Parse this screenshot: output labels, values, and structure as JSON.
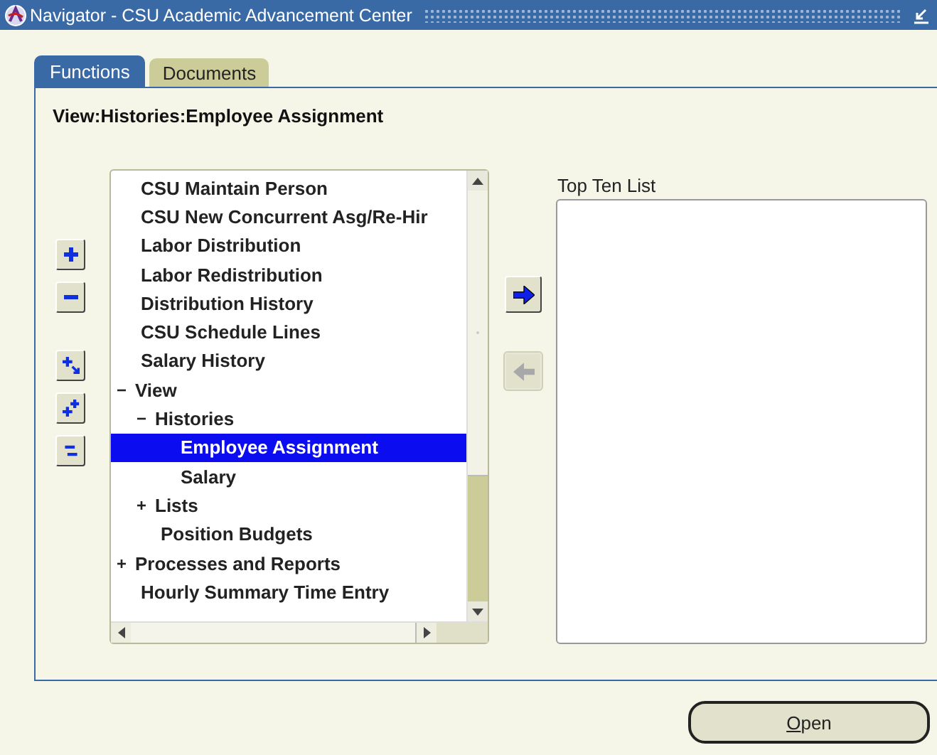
{
  "window": {
    "title": "Navigator - CSU Academic Advancement Center"
  },
  "tabs": [
    {
      "label": "Functions",
      "selected": true
    },
    {
      "label": "Documents",
      "selected": false
    }
  ],
  "path": "View:Histories:Employee Assignment",
  "tree": [
    {
      "label": "CSU Maintain Person",
      "selected": false
    },
    {
      "label": "CSU New Concurrent Asg/Re-Hir",
      "selected": false
    },
    {
      "label": "Labor Distribution",
      "selected": false
    },
    {
      "label": "Labor Redistribution",
      "selected": false
    },
    {
      "label": "Distribution History",
      "selected": false
    },
    {
      "label": "CSU Schedule Lines",
      "selected": false
    },
    {
      "label": "Salary History",
      "selected": false
    },
    {
      "label": "View",
      "selected": false,
      "expanded": true,
      "children": [
        {
          "label": "Histories",
          "selected": false,
          "expanded": true,
          "children": [
            {
              "label": "Employee Assignment",
              "selected": true
            },
            {
              "label": "Salary",
              "selected": false
            }
          ]
        },
        {
          "label": "Lists",
          "selected": false,
          "expanded": false
        },
        {
          "label": "Position Budgets",
          "selected": false
        }
      ]
    },
    {
      "label": "Processes and Reports",
      "selected": false,
      "expanded": false
    },
    {
      "label": "Hourly Summary Time Entry",
      "selected": false
    }
  ],
  "top_ten": {
    "label": "Top Ten List"
  },
  "open_button": {
    "label": "Open",
    "mnemonic_underlined": true
  }
}
